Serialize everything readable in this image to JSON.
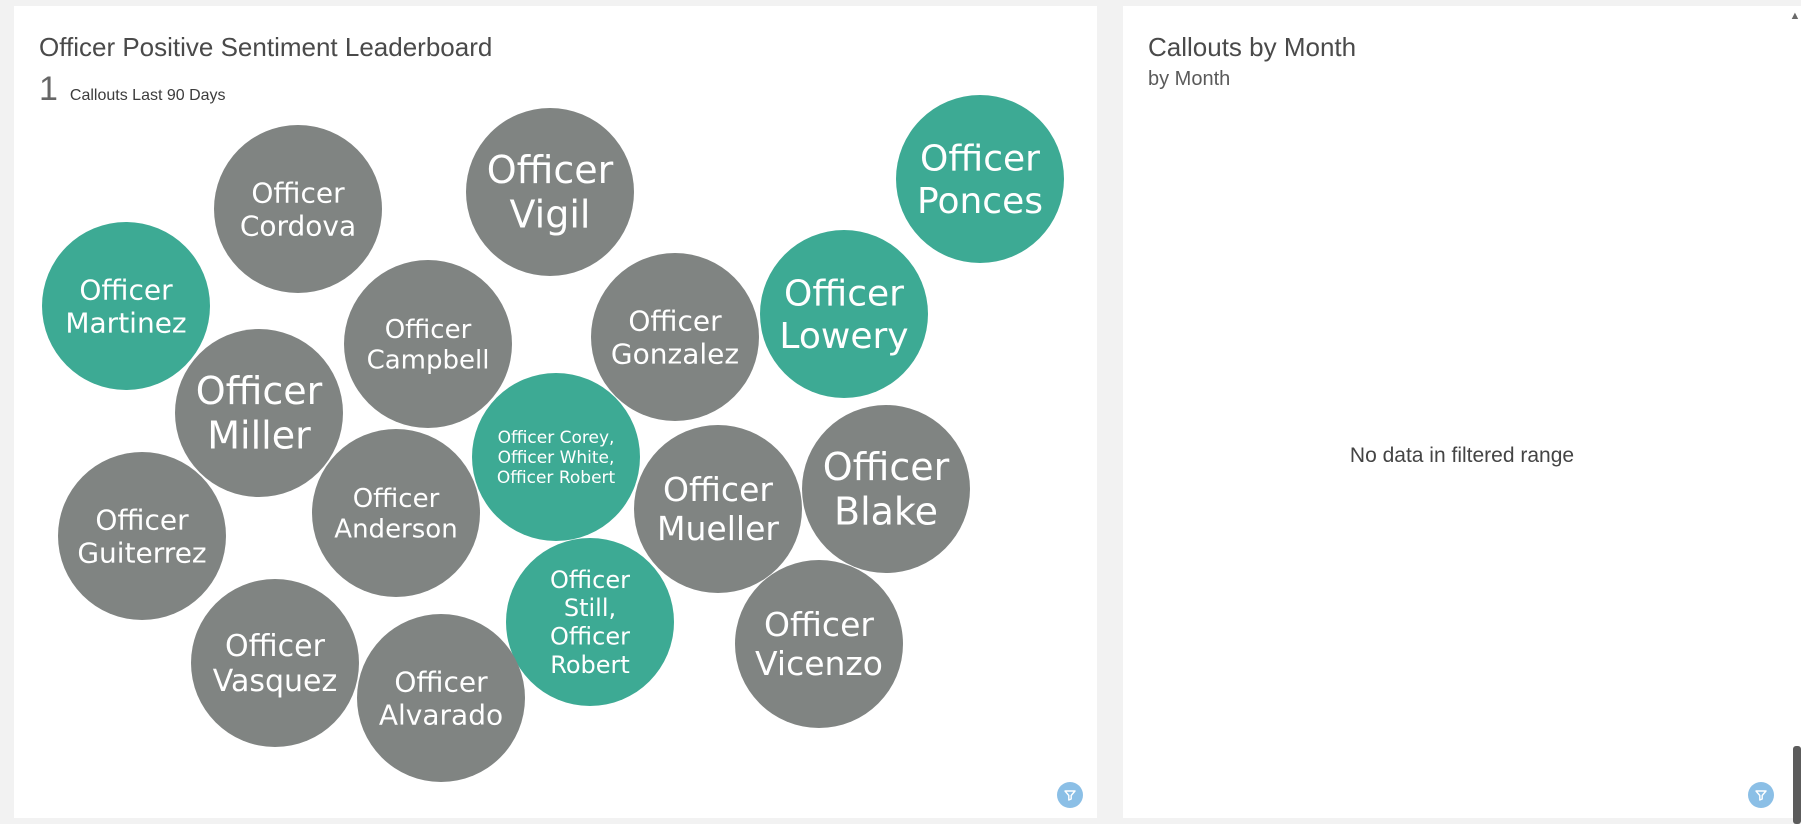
{
  "leaderboard": {
    "title": "Officer Positive Sentiment Leaderboard",
    "kpi_value": "1",
    "kpi_label": "Callouts Last 90 Days",
    "colors": {
      "highlight": "#3daa94",
      "neutral": "#808482"
    },
    "bubbles": [
      {
        "lines": [
          "Officer",
          "Cordova"
        ],
        "highlight": false
      },
      {
        "lines": [
          "Officer",
          "Vigil"
        ],
        "highlight": false
      },
      {
        "lines": [
          "Officer",
          "Ponces"
        ],
        "highlight": true
      },
      {
        "lines": [
          "Officer",
          "Martinez"
        ],
        "highlight": true
      },
      {
        "lines": [
          "Officer",
          "Campbell"
        ],
        "highlight": false
      },
      {
        "lines": [
          "Officer",
          "Gonzalez"
        ],
        "highlight": false
      },
      {
        "lines": [
          "Officer",
          "Lowery"
        ],
        "highlight": true
      },
      {
        "lines": [
          "Officer",
          "Miller"
        ],
        "highlight": false
      },
      {
        "lines": [
          "Officer Corey,",
          "Officer White,",
          "Officer Robert"
        ],
        "highlight": true
      },
      {
        "lines": [
          "Officer",
          "Guiterrez"
        ],
        "highlight": false
      },
      {
        "lines": [
          "Officer",
          "Anderson"
        ],
        "highlight": false
      },
      {
        "lines": [
          "Officer",
          "Mueller"
        ],
        "highlight": false
      },
      {
        "lines": [
          "Officer",
          "Blake"
        ],
        "highlight": false
      },
      {
        "lines": [
          "Officer",
          "Still,",
          "Officer",
          "Robert"
        ],
        "highlight": true
      },
      {
        "lines": [
          "Officer",
          "Vasquez"
        ],
        "highlight": false
      },
      {
        "lines": [
          "Officer",
          "Alvarado"
        ],
        "highlight": false
      },
      {
        "lines": [
          "Officer",
          "Vicenzo"
        ],
        "highlight": false
      }
    ],
    "filter_icon": "filter-icon"
  },
  "callouts": {
    "title": "Callouts by Month",
    "subtitle": "by Month",
    "empty_message": "No data in filtered range",
    "filter_icon": "filter-icon"
  }
}
